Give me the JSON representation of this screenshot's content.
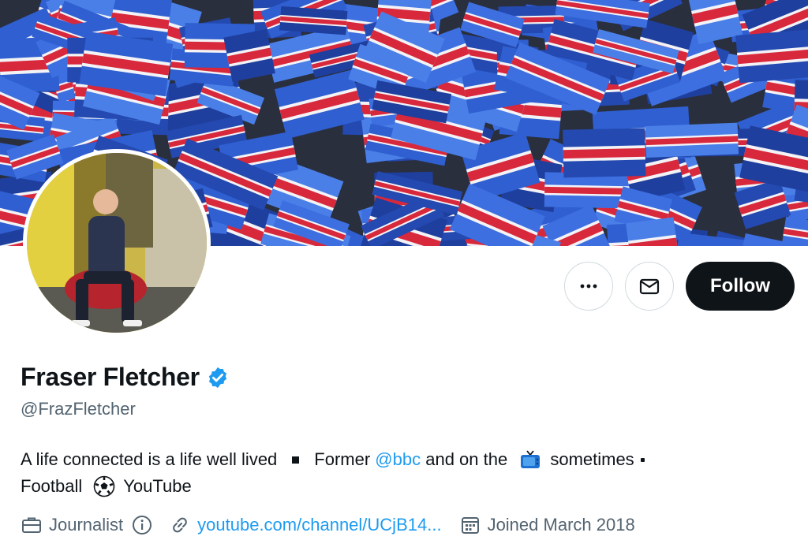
{
  "profile": {
    "name": "Fraser Fletcher",
    "handle": "@FrazFletcher",
    "verified": true
  },
  "actions": {
    "more_icon": "more-dots-icon",
    "message_icon": "envelope-icon",
    "follow_label": "Follow"
  },
  "bio": {
    "part1": "A life connected is a life well lived",
    "part2": "Former ",
    "mention": "@bbc",
    "part3": " and on the ",
    "part4": "sometimes",
    "part5": "Football",
    "part6": "YouTube"
  },
  "meta": {
    "category": "Journalist",
    "website": "youtube.com/channel/UCjB14...",
    "joined": "Joined March 2018"
  },
  "colors": {
    "accent": "#1d9bf0",
    "text": "#0f1419",
    "secondary": "#536471",
    "button_dark": "#0f1419"
  }
}
